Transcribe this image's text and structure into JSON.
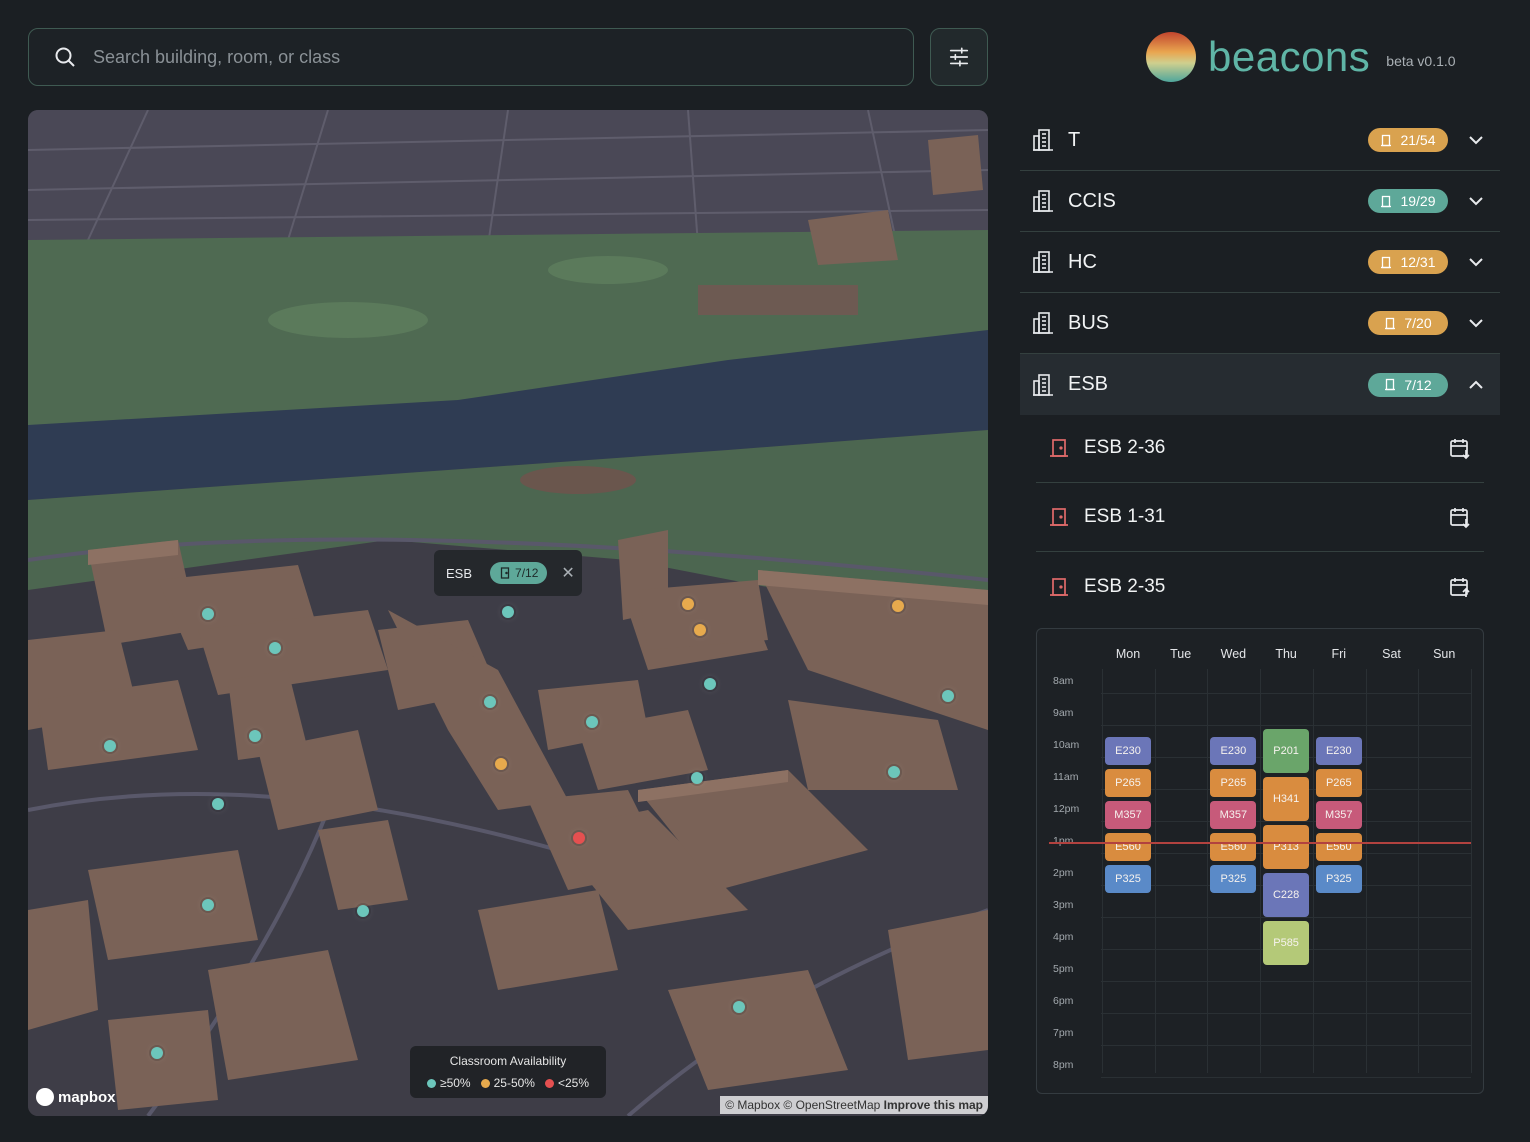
{
  "search": {
    "placeholder": "Search building, room, or class"
  },
  "brand": {
    "name": "beacons",
    "version": "beta v0.1.0"
  },
  "map": {
    "popup": {
      "building": "ESB",
      "availability": "7/12"
    },
    "legend": {
      "title": "Classroom Availability",
      "items": [
        {
          "label": "≥50%",
          "color": "#6cc6bb"
        },
        {
          "label": "25-50%",
          "color": "#e7aa4d"
        },
        {
          "label": "<25%",
          "color": "#e55050"
        }
      ]
    },
    "logo": "mapbox",
    "attribution": {
      "text": "© Mapbox © OpenStreetMap",
      "link": "Improve this map"
    }
  },
  "buildings": [
    {
      "name": "T",
      "availability": "21/54",
      "status": "orange",
      "expanded": false
    },
    {
      "name": "CCIS",
      "availability": "19/29",
      "status": "green",
      "expanded": false
    },
    {
      "name": "HC",
      "availability": "12/31",
      "status": "orange",
      "expanded": false
    },
    {
      "name": "BUS",
      "availability": "7/20",
      "status": "orange",
      "expanded": false
    },
    {
      "name": "ESB",
      "availability": "7/12",
      "status": "green",
      "expanded": true
    }
  ],
  "rooms": [
    {
      "name": "ESB 2-36"
    },
    {
      "name": "ESB 1-31"
    },
    {
      "name": "ESB 2-35"
    }
  ],
  "schedule": {
    "days": [
      "Mon",
      "Tue",
      "Wed",
      "Thu",
      "Fri",
      "Sat",
      "Sun"
    ],
    "hours": [
      "8am",
      "9am",
      "10am",
      "11am",
      "12pm",
      "1pm",
      "2pm",
      "3pm",
      "4pm",
      "5pm",
      "6pm",
      "7pm",
      "8pm"
    ],
    "events": [
      {
        "day": 0,
        "label": "E230",
        "color": "#6b76b8",
        "start": 10,
        "end": 11
      },
      {
        "day": 0,
        "label": "P265",
        "color": "#d98c3f",
        "start": 11,
        "end": 12
      },
      {
        "day": 0,
        "label": "M357",
        "color": "#c75a7a",
        "start": 12,
        "end": 13
      },
      {
        "day": 0,
        "label": "E560",
        "color": "#d98c3f",
        "start": 13,
        "end": 14
      },
      {
        "day": 0,
        "label": "P325",
        "color": "#5a8ac8",
        "start": 14,
        "end": 15
      },
      {
        "day": 2,
        "label": "E230",
        "color": "#6b76b8",
        "start": 10,
        "end": 11
      },
      {
        "day": 2,
        "label": "P265",
        "color": "#d98c3f",
        "start": 11,
        "end": 12
      },
      {
        "day": 2,
        "label": "M357",
        "color": "#c75a7a",
        "start": 12,
        "end": 13
      },
      {
        "day": 2,
        "label": "E560",
        "color": "#d98c3f",
        "start": 13,
        "end": 14
      },
      {
        "day": 2,
        "label": "P325",
        "color": "#5a8ac8",
        "start": 14,
        "end": 15
      },
      {
        "day": 3,
        "label": "P201",
        "color": "#6aa56a",
        "start": 9.75,
        "end": 11.25
      },
      {
        "day": 3,
        "label": "H341",
        "color": "#d98c3f",
        "start": 11.25,
        "end": 12.75
      },
      {
        "day": 3,
        "label": "P313",
        "color": "#d98c3f",
        "start": 12.75,
        "end": 14.25
      },
      {
        "day": 3,
        "label": "C228",
        "color": "#6b76b8",
        "start": 14.25,
        "end": 15.75
      },
      {
        "day": 3,
        "label": "P585",
        "color": "#b4c978",
        "start": 15.75,
        "end": 17.25
      },
      {
        "day": 4,
        "label": "E230",
        "color": "#6b76b8",
        "start": 10,
        "end": 11
      },
      {
        "day": 4,
        "label": "P265",
        "color": "#d98c3f",
        "start": 11,
        "end": 12
      },
      {
        "day": 4,
        "label": "M357",
        "color": "#c75a7a",
        "start": 12,
        "end": 13
      },
      {
        "day": 4,
        "label": "E560",
        "color": "#d98c3f",
        "start": 13,
        "end": 14
      },
      {
        "day": 4,
        "label": "P325",
        "color": "#5a8ac8",
        "start": 14,
        "end": 15
      }
    ],
    "now_hour": 13
  }
}
